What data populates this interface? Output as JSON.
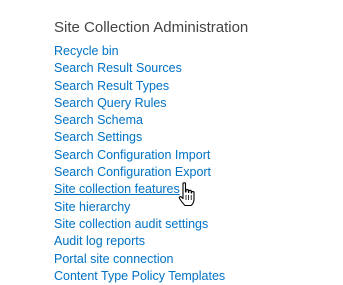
{
  "section": {
    "title": "Site Collection Administration",
    "links": [
      {
        "label": "Recycle bin"
      },
      {
        "label": "Search Result Sources"
      },
      {
        "label": "Search Result Types"
      },
      {
        "label": "Search Query Rules"
      },
      {
        "label": "Search Schema"
      },
      {
        "label": "Search Settings"
      },
      {
        "label": "Search Configuration Import"
      },
      {
        "label": "Search Configuration Export"
      },
      {
        "label": "Site collection features"
      },
      {
        "label": "Site hierarchy"
      },
      {
        "label": "Site collection audit settings"
      },
      {
        "label": "Audit log reports"
      },
      {
        "label": "Portal site connection"
      },
      {
        "label": "Content Type Policy Templates"
      }
    ]
  },
  "colors": {
    "link": "#0072c6",
    "title": "#444444",
    "background": "#ffffff"
  },
  "hover_state": {
    "hovered_link": "Site collection features",
    "cursor_icon": "hand-pointer-icon"
  }
}
